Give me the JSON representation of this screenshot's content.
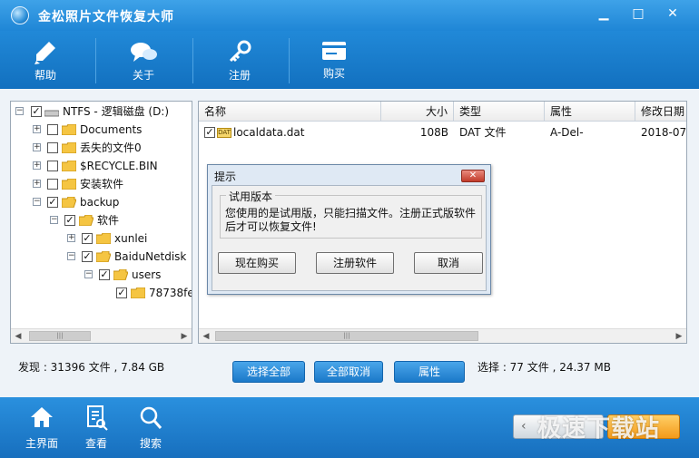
{
  "window": {
    "title": "金松照片文件恢复大师",
    "minimize_glyph": "▁",
    "maximize_glyph": "□",
    "close_glyph": "✕"
  },
  "toolbar": {
    "items": [
      {
        "label": "帮助",
        "icon": "pen-icon"
      },
      {
        "label": "关于",
        "icon": "chat-bubbles-icon"
      },
      {
        "label": "注册",
        "icon": "key-icon"
      },
      {
        "label": "购买",
        "icon": "card-icon"
      }
    ]
  },
  "tree": {
    "root": "NTFS - 逻辑磁盘 (D:)",
    "items": [
      {
        "label": "Documents"
      },
      {
        "label": "丢失的文件0"
      },
      {
        "label": "$RECYCLE.BIN"
      },
      {
        "label": "安装软件"
      },
      {
        "label": "backup"
      },
      {
        "label": "软件"
      },
      {
        "label": "xunlei"
      },
      {
        "label": "BaiduNetdisk"
      },
      {
        "label": "users"
      },
      {
        "label": "78738fe"
      }
    ],
    "expand_plus": "+",
    "expand_minus": "−",
    "check_mark": "✓"
  },
  "file_list": {
    "columns": [
      "名称",
      "大小",
      "类型",
      "属性",
      "修改日期"
    ],
    "rows": [
      {
        "name": "localdata.dat",
        "icon_text": "DAT",
        "size": "108B",
        "type": "DAT 文件",
        "attr": "A-Del-",
        "date": "2018-07-"
      }
    ]
  },
  "scroll": {
    "left": "◀",
    "right": "▶",
    "thumb": "|||"
  },
  "status": {
    "found": "发现 : 31396 文件 , 7.84 GB",
    "selected": "选择 : 77 文件 , 24.37 MB"
  },
  "actions": {
    "select_all": "选择全部",
    "deselect_all": "全部取消",
    "properties": "属性"
  },
  "dialog": {
    "title": "提示",
    "close_glyph": "✕",
    "group_title": "试用版本",
    "message": "您使用的是试用版，只能扫描文件。注册正式版软件后才可以恢复文件!",
    "buy_now": "现在购买",
    "register": "注册软件",
    "cancel": "取消"
  },
  "bottom_nav": {
    "items": [
      {
        "label": "主界面",
        "icon": "home-icon"
      },
      {
        "label": "查看",
        "icon": "view-document-icon"
      },
      {
        "label": "搜索",
        "icon": "search-icon"
      }
    ],
    "back_glyph": "‹",
    "watermark": "极速下载站"
  },
  "colors": {
    "brand_blue": "#1b7fd0",
    "accent_orange": "#f39a1a"
  }
}
